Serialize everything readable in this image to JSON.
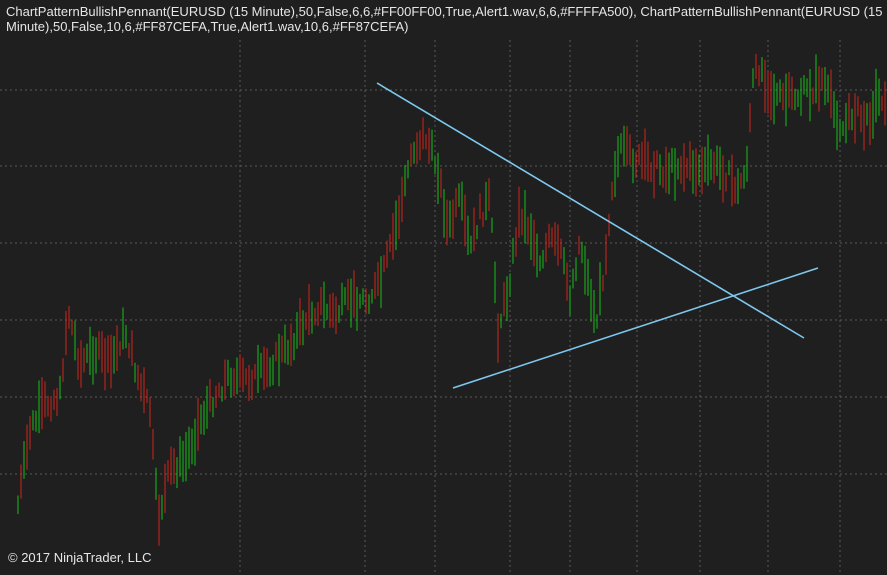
{
  "chart": {
    "indicator_label": "ChartPatternBullishPennant(EURUSD (15 Minute),50,False,6,6,#FF00FF00,True,Alert1.wav,6,6,#FFFFA500), ChartPatternBullishPennant(EURUSD (15 Minute),50,False,10,6,#FF87CEFA,True,Alert1.wav,10,6,#FF87CEFA)",
    "copyright": "© 2017 NinjaTrader, LLC"
  },
  "colors": {
    "background": "#1f1f1f",
    "up_candle": "#16c116",
    "down_candle": "#d0261d",
    "trendline": "#7ec8f0",
    "grid": "#5a5a5a",
    "text": "#e6e6e6"
  },
  "chart_data": {
    "type": "candlestick",
    "instrument": "EURUSD",
    "timeframe": "15 Minute",
    "grid": true,
    "pattern": "Bullish Pennant",
    "series": [
      {
        "name": "EURUSD",
        "type": "candlestick"
      }
    ]
  }
}
